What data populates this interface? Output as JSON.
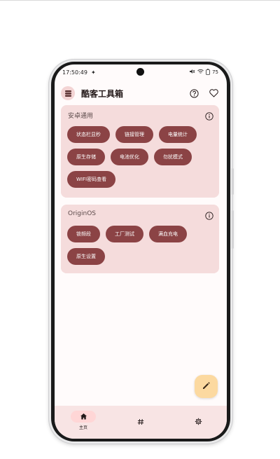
{
  "status_bar": {
    "time": "17:50:49",
    "right_text": "75"
  },
  "app": {
    "title": "酷客工具箱",
    "icons": {
      "logo": "stack-icon",
      "help": "help-circle-icon",
      "favorite": "heart-icon"
    }
  },
  "sections": [
    {
      "title": "安卓通用",
      "chips": [
        "状态栏显秒",
        "链接管理",
        "电量统计",
        "原生存储",
        "电池优化",
        "勿扰模式",
        "WIFI密码查看"
      ]
    },
    {
      "title": "OriginOS",
      "chips": [
        "锁频段",
        "工厂测试",
        "满血充电",
        "原生设置"
      ]
    }
  ],
  "fab": {
    "icon": "edit-pencil-icon"
  },
  "bottom_nav": [
    {
      "icon": "home-icon",
      "label": "主页",
      "active": true
    },
    {
      "icon": "hash-icon",
      "label": "",
      "active": false
    },
    {
      "icon": "gear-icon",
      "label": "",
      "active": false
    }
  ],
  "colors": {
    "chip_bg": "#8b4345",
    "card_bg": "#f5dcdc",
    "fab_bg": "#fcd9a0",
    "nav_bg": "#f8e4e4",
    "screen_bg": "#fffbfb"
  }
}
